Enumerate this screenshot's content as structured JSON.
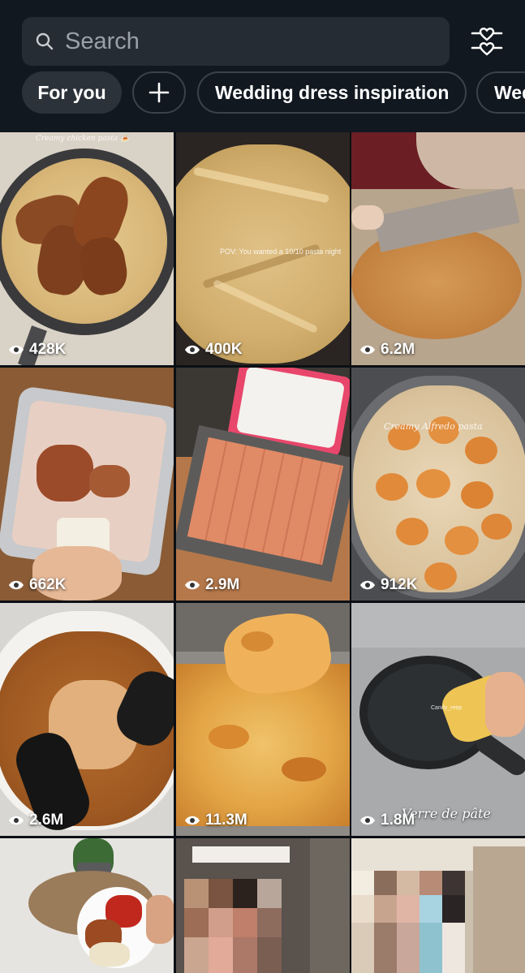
{
  "search": {
    "placeholder": "Search"
  },
  "chips": [
    {
      "label": "For you"
    },
    {
      "label": "+"
    },
    {
      "label": "Wedding dress inspiration"
    },
    {
      "label": "Wedding"
    }
  ],
  "tiles": [
    {
      "views": "428K",
      "caption": "Creamy chicken pasta 🍝"
    },
    {
      "views": "400K",
      "caption": "POV: You wanted a 10/10 pasta night"
    },
    {
      "views": "6.2M"
    },
    {
      "views": "662K"
    },
    {
      "views": "2.9M"
    },
    {
      "views": "912K",
      "caption": "Creamy Alfredo pasta"
    },
    {
      "views": "2.6M"
    },
    {
      "views": "11.3M"
    },
    {
      "views": "1.8M",
      "overlay": "Verre de pâte",
      "caption": "Candy_reep"
    },
    {
      "views": ""
    },
    {
      "views": ""
    },
    {
      "views": ""
    }
  ],
  "colors": {
    "background": "#111820",
    "chip_active": "#2c3239",
    "search_bg": "#262c33"
  }
}
